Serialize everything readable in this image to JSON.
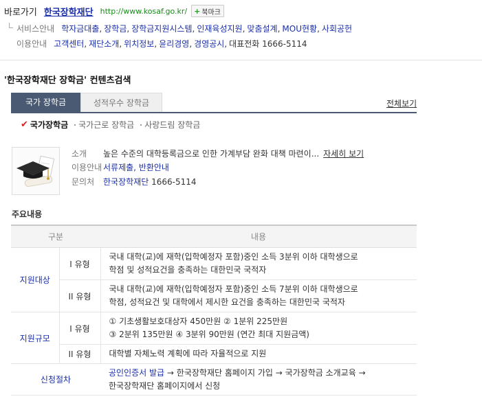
{
  "header": {
    "shortcut_label": "바로가기",
    "site_name": "한국장학재단",
    "site_url": "http://www.kosaf.go.kr/",
    "bookmark_label": "북마크",
    "services_label": "서비스안내",
    "services": [
      "학자금대출",
      "장학금",
      "장학금지원시스템",
      "인재육성지원",
      "맞춤설계",
      "MOU현황",
      "사회공헌"
    ],
    "usage_label": "이용안내",
    "usage": [
      "고객센터",
      "재단소개",
      "위치정보",
      "윤리경영",
      "경영공시"
    ],
    "rep_phone": "대표전화 1666-5114"
  },
  "section": {
    "title": "'한국장학재단 장학금' 컨텐츠검색",
    "tabs": [
      "국가 장학금",
      "성적우수 장학금"
    ],
    "view_all": "전체보기",
    "subtabs": [
      "국가장학금",
      "국가근로 장학금",
      "사랑드림 장학금"
    ]
  },
  "summary": {
    "intro_key": "소개",
    "intro_value": "높은 수준의 대학등록금으로 인한 가계부담 완화 대책 마련이...",
    "intro_more": "자세히 보기",
    "usage_key": "이용안내",
    "usage_links": "서류제출, 반환안내",
    "contact_key": "문의처",
    "contact_name": "한국장학재단",
    "contact_phone": "1666-5114"
  },
  "table": {
    "heading": "주요내용",
    "col_category": "구분",
    "col_content": "내용",
    "target_label": "지원대상",
    "scale_label": "지원규모",
    "process_label": "신청절차",
    "type1": "I 유형",
    "type2": "II 유형",
    "target_t1_l1": "국내 대학(교)에 재학(입학예정자 포함)중인 소득 3분위 이하 대학생으로",
    "target_t1_l2": "학점 및 성적요건을 충족하는 대한민국 국적자",
    "target_t2_l1": "국내 대학(교)에 재학(입학예정자 포함)중인 소득 7분위 이하 대학생으로",
    "target_t2_l2": "학점, 성적요건 및 대학에서 제시한 요건을 충족하는 대한민국 국적자",
    "scale_t1_l1": "① 기초생활보호대상자 450만원 ② 1분위 225만원",
    "scale_t1_l2": "③ 2분위 135만원 ④ 3분위 90만원 (연간 최대 지원금액)",
    "scale_t2": "대학별 자체노력 계획에 따라 자율적으로 지원",
    "process_link": "공인인증서 발급",
    "process_l1_rest": " → 한국장학재단 홈페이지 가입 → 국가장학금 소개교육 →",
    "process_l2": "한국장학재단 홈페이지에서 신청"
  },
  "colors": {
    "link": "#1b2fa8",
    "url": "#1a8a1a",
    "tab_active": "#4a5a73",
    "check": "#dd2222"
  }
}
